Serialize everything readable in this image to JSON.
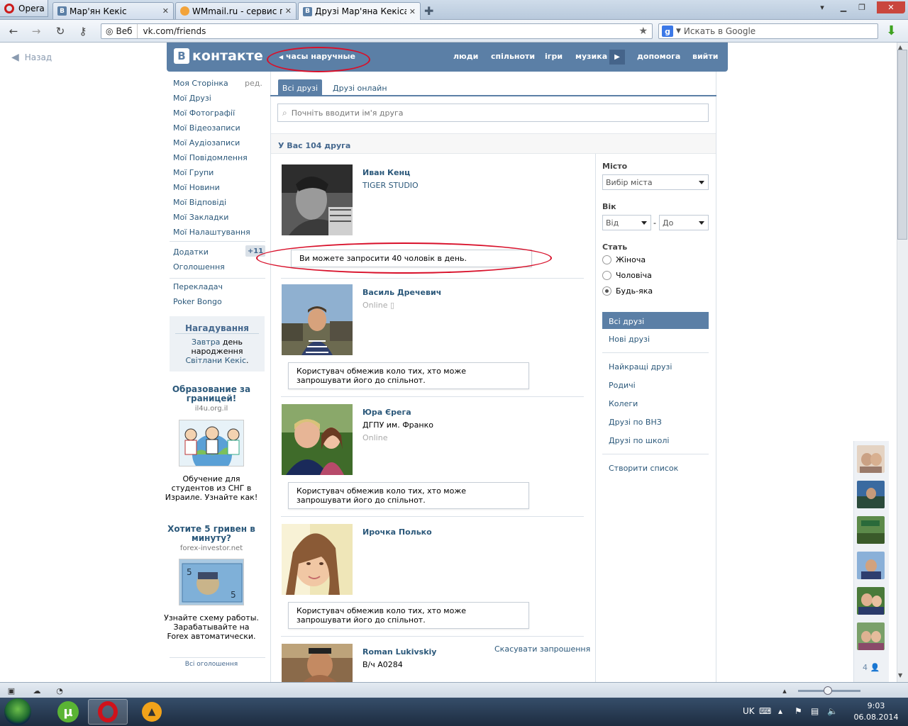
{
  "browser": {
    "opera_label": "Opera",
    "tabs": [
      {
        "title": "Мар'ян Кекіс"
      },
      {
        "title": "WMmail.ru - сервис п..."
      },
      {
        "title": "Друзі Мар'яна Кекіса |..."
      }
    ],
    "address": {
      "web_label": "Веб",
      "url": "vk.com/friends"
    },
    "search": {
      "placeholder": "Искать в Google"
    },
    "back_label": "Назад"
  },
  "vk": {
    "logo": "контакте",
    "status": "часы наручные",
    "nav": [
      "люди",
      "спільноти",
      "ігри",
      "музика",
      "допомога",
      "вийти"
    ],
    "left_menu": {
      "items": [
        "Моя Сторінка",
        "Мої Друзі",
        "Мої Фотографії",
        "Мої Відеозаписи",
        "Мої Аудіозаписи",
        "Мої Повідомлення",
        "Мої Групи",
        "Мої Новини",
        "Мої Відповіді",
        "Мої Закладки",
        "Мої Налаштування"
      ],
      "edit": "ред.",
      "apps": "Додатки",
      "apps_badge": "+11",
      "ads": "Оголошення",
      "extra": [
        "Перекладач",
        "Poker Bongo"
      ]
    },
    "reminder": {
      "title": "Нагадування",
      "w1": "Завтра",
      "w2": " день народження ",
      "w3": "Світлани Кекіс",
      "w4": "."
    },
    "ad1": {
      "title": "Образование за границей!",
      "domain": "il4u.org.il",
      "body": "Обучение для студентов из СНГ в Израиле. Узнайте как!"
    },
    "ad2": {
      "title": "Хотите 5 гривен в минуту?",
      "domain": "forex-investor.net",
      "body": "Узнайте схему работы. Зарабатывайте на Forex автоматически."
    },
    "all_ads": "Всі оголошення",
    "tabs": {
      "all": "Всі друзі",
      "online": "Друзі онлайн"
    },
    "search_placeholder": "Почніть вводити ім'я друга",
    "count_text": "У Вас 104 друга",
    "friends": [
      {
        "name": "Иван Кенц",
        "sub": "TIGER STUDIO",
        "online": "",
        "notice": "Ви можете запросити 40 чоловік в день."
      },
      {
        "name": "Василь Дречевич",
        "sub": "",
        "online": "Online",
        "notice": "Користувач обмежив коло тих, хто може запрошувати його до спільнот."
      },
      {
        "name": "Юра Єрега",
        "sub": "ДГПУ им. Франко",
        "online": "Online",
        "notice": "Користувач обмежив коло тих, хто може запрошувати його до спільнот."
      },
      {
        "name": "Ирочка Полько",
        "sub": "",
        "online": "",
        "notice": "Користувач обмежив коло тих, хто може запрошувати його до спільнот."
      },
      {
        "name": "Roman Lukivskiy",
        "sub": "В/ч А0284",
        "online": "",
        "notice": ""
      }
    ],
    "cancel_invite": "Скасувати запрошення",
    "filters": {
      "city_label": "Місто",
      "city_value": "Вибір міста",
      "age_label": "Вік",
      "age_from": "Від",
      "age_dash": "-",
      "age_to": "До",
      "sex_label": "Стать",
      "sex_options": [
        "Жіноча",
        "Чоловіча",
        "Будь-яка"
      ],
      "sex_selected": "Будь-яка",
      "lists": [
        "Всі друзі",
        "Нові друзі"
      ],
      "categories": [
        "Найкращі друзі",
        "Родичі",
        "Колеги",
        "Друзі по ВНЗ",
        "Друзі по школі"
      ],
      "create": "Створити список"
    },
    "chat_count": "4"
  },
  "taskbar": {
    "lang": "UK",
    "time": "9:03",
    "date": "06.08.2014"
  },
  "colors": {
    "vk_blue": "#5b7fa6",
    "link": "#2b587a",
    "annotation_red": "#d8102a"
  }
}
